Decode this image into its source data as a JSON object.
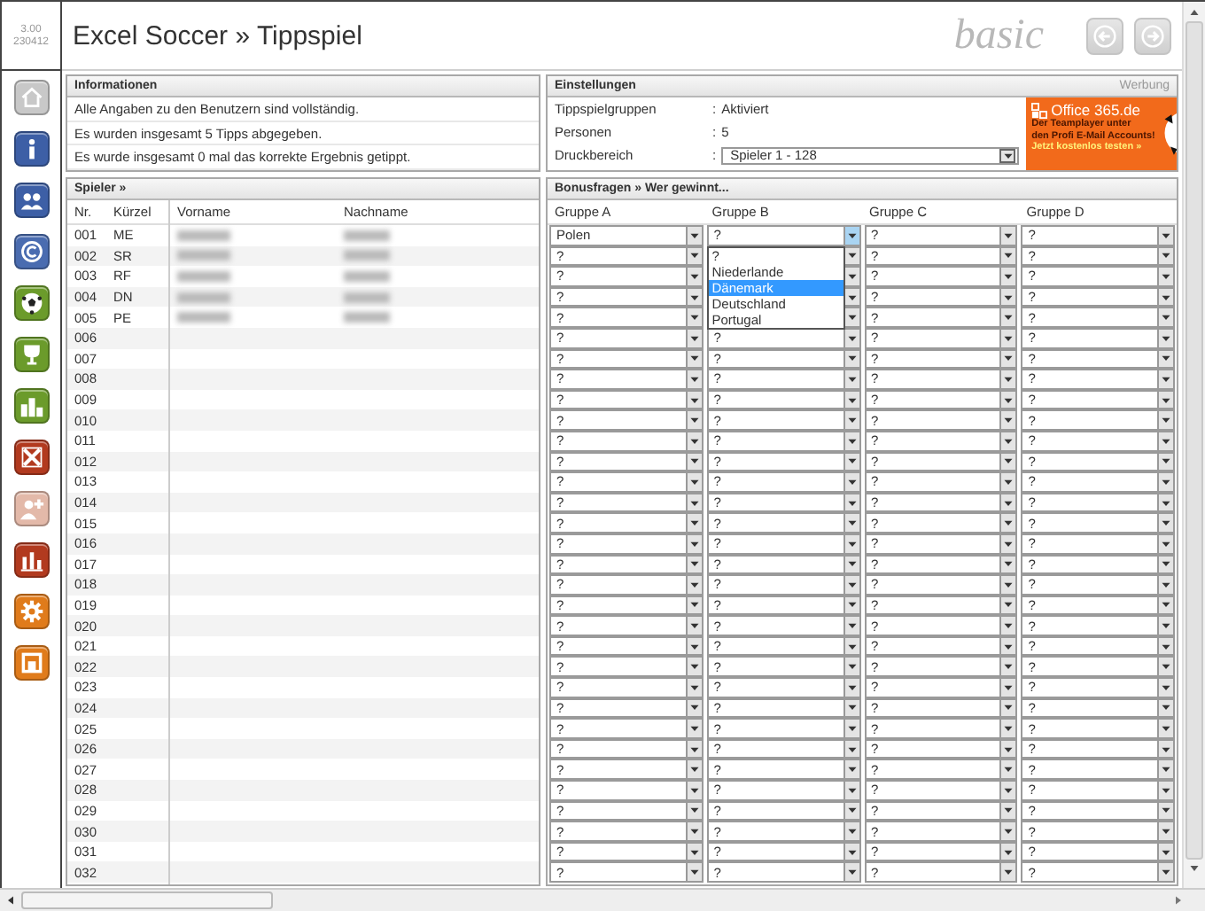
{
  "version": {
    "number": "3.00",
    "build": "230412"
  },
  "header": {
    "title": "Excel Soccer » Tippspiel",
    "edition": "basic"
  },
  "sidebar": {
    "items": [
      {
        "kind": "home",
        "color": "#c8c8c8"
      },
      {
        "kind": "info",
        "color": "#3d5fa6"
      },
      {
        "kind": "users",
        "color": "#3d5fa6"
      },
      {
        "kind": "copyright",
        "color": "#4a6cb0"
      },
      {
        "kind": "ball",
        "color": "#6b9b2b"
      },
      {
        "kind": "trophy",
        "color": "#6b9b2b"
      },
      {
        "kind": "ranking",
        "color": "#6b9b2b"
      },
      {
        "kind": "cross",
        "color": "#b23a1f"
      },
      {
        "kind": "adduser",
        "color": "#e3b9a9"
      },
      {
        "kind": "chart",
        "color": "#b23a1f"
      },
      {
        "kind": "settings",
        "color": "#e07b1b"
      },
      {
        "kind": "stop",
        "color": "#e07b1b"
      }
    ]
  },
  "info": {
    "title": "Informationen",
    "lines": [
      "Alle Angaben zu den Benutzern sind vollständig.",
      "Es wurden insgesamt 5 Tipps abgegeben.",
      "Es wurde insgesamt 0 mal das korrekte Ergebnis getippt."
    ]
  },
  "settings": {
    "title": "Einstellungen",
    "ad_label": "Werbung",
    "rows": [
      {
        "label": "Tippspielgruppen",
        "separator": ":",
        "value": "Aktiviert",
        "kind": "text"
      },
      {
        "label": "Personen",
        "separator": ":",
        "value": "5",
        "kind": "text"
      },
      {
        "label": "Druckbereich",
        "separator": ":",
        "value": "Spieler 1 - 128",
        "kind": "select"
      }
    ],
    "ad": {
      "brand": "Office 365.de",
      "lines": [
        "Der Teamplayer unter",
        "den Profi E-Mail Accounts!"
      ],
      "cta": "Jetzt kostenlos testen »"
    }
  },
  "players": {
    "title": "Spieler »",
    "columns": [
      "Nr.",
      "Kürzel",
      "Vorname",
      "Nachname"
    ],
    "rows": [
      {
        "nr": "001",
        "short": "ME",
        "blurred": true
      },
      {
        "nr": "002",
        "short": "SR",
        "blurred": true
      },
      {
        "nr": "003",
        "short": "RF",
        "blurred": true
      },
      {
        "nr": "004",
        "short": "DN",
        "blurred": true
      },
      {
        "nr": "005",
        "short": "PE",
        "blurred": true
      },
      {
        "nr": "006",
        "blurred": false
      },
      {
        "nr": "007",
        "blurred": false
      },
      {
        "nr": "008",
        "blurred": false
      },
      {
        "nr": "009",
        "blurred": false
      },
      {
        "nr": "010",
        "blurred": false
      },
      {
        "nr": "011",
        "blurred": false
      },
      {
        "nr": "012",
        "blurred": false
      },
      {
        "nr": "013",
        "blurred": false
      },
      {
        "nr": "014",
        "blurred": false
      },
      {
        "nr": "015",
        "blurred": false
      },
      {
        "nr": "016",
        "blurred": false
      },
      {
        "nr": "017",
        "blurred": false
      },
      {
        "nr": "018",
        "blurred": false
      },
      {
        "nr": "019",
        "blurred": false
      },
      {
        "nr": "020",
        "blurred": false
      },
      {
        "nr": "021",
        "blurred": false
      },
      {
        "nr": "022",
        "blurred": false
      },
      {
        "nr": "023",
        "blurred": false
      },
      {
        "nr": "024",
        "blurred": false
      },
      {
        "nr": "025",
        "blurred": false
      },
      {
        "nr": "026",
        "blurred": false
      },
      {
        "nr": "027",
        "blurred": false
      },
      {
        "nr": "028",
        "blurred": false
      },
      {
        "nr": "029",
        "blurred": false
      },
      {
        "nr": "030",
        "blurred": false
      },
      {
        "nr": "031",
        "blurred": false
      },
      {
        "nr": "032",
        "blurred": false
      }
    ]
  },
  "bonus": {
    "title": "Bonusfragen » Wer gewinnt...",
    "columns": [
      {
        "title": "Gruppe A",
        "open": false
      },
      {
        "title": "Gruppe B",
        "open": true
      },
      {
        "title": "Gruppe C",
        "open": false
      },
      {
        "title": "Gruppe D",
        "open": false
      }
    ],
    "dropdown": {
      "options": [
        {
          "label": "?",
          "selected": false
        },
        {
          "label": "Niederlande",
          "selected": false
        },
        {
          "label": "Dänemark",
          "selected": true
        },
        {
          "label": "Deutschland",
          "selected": false
        },
        {
          "label": "Portugal",
          "selected": false
        }
      ]
    },
    "rows": [
      [
        "Polen",
        "?",
        "?",
        "?"
      ],
      [
        "?",
        null,
        "?",
        "?"
      ],
      [
        "?",
        null,
        "?",
        "?"
      ],
      [
        "?",
        null,
        "?",
        "?"
      ],
      [
        "?",
        null,
        "?",
        "?"
      ],
      [
        "?",
        "?",
        "?",
        "?"
      ],
      [
        "?",
        "?",
        "?",
        "?"
      ],
      [
        "?",
        "?",
        "?",
        "?"
      ],
      [
        "?",
        "?",
        "?",
        "?"
      ],
      [
        "?",
        "?",
        "?",
        "?"
      ],
      [
        "?",
        "?",
        "?",
        "?"
      ],
      [
        "?",
        "?",
        "?",
        "?"
      ],
      [
        "?",
        "?",
        "?",
        "?"
      ],
      [
        "?",
        "?",
        "?",
        "?"
      ],
      [
        "?",
        "?",
        "?",
        "?"
      ],
      [
        "?",
        "?",
        "?",
        "?"
      ],
      [
        "?",
        "?",
        "?",
        "?"
      ],
      [
        "?",
        "?",
        "?",
        "?"
      ],
      [
        "?",
        "?",
        "?",
        "?"
      ],
      [
        "?",
        "?",
        "?",
        "?"
      ],
      [
        "?",
        "?",
        "?",
        "?"
      ],
      [
        "?",
        "?",
        "?",
        "?"
      ],
      [
        "?",
        "?",
        "?",
        "?"
      ],
      [
        "?",
        "?",
        "?",
        "?"
      ],
      [
        "?",
        "?",
        "?",
        "?"
      ],
      [
        "?",
        "?",
        "?",
        "?"
      ],
      [
        "?",
        "?",
        "?",
        "?"
      ],
      [
        "?",
        "?",
        "?",
        "?"
      ],
      [
        "?",
        "?",
        "?",
        "?"
      ],
      [
        "?",
        "?",
        "?",
        "?"
      ],
      [
        "?",
        "?",
        "?",
        "?"
      ],
      [
        "?",
        "?",
        "?",
        "?"
      ]
    ]
  }
}
